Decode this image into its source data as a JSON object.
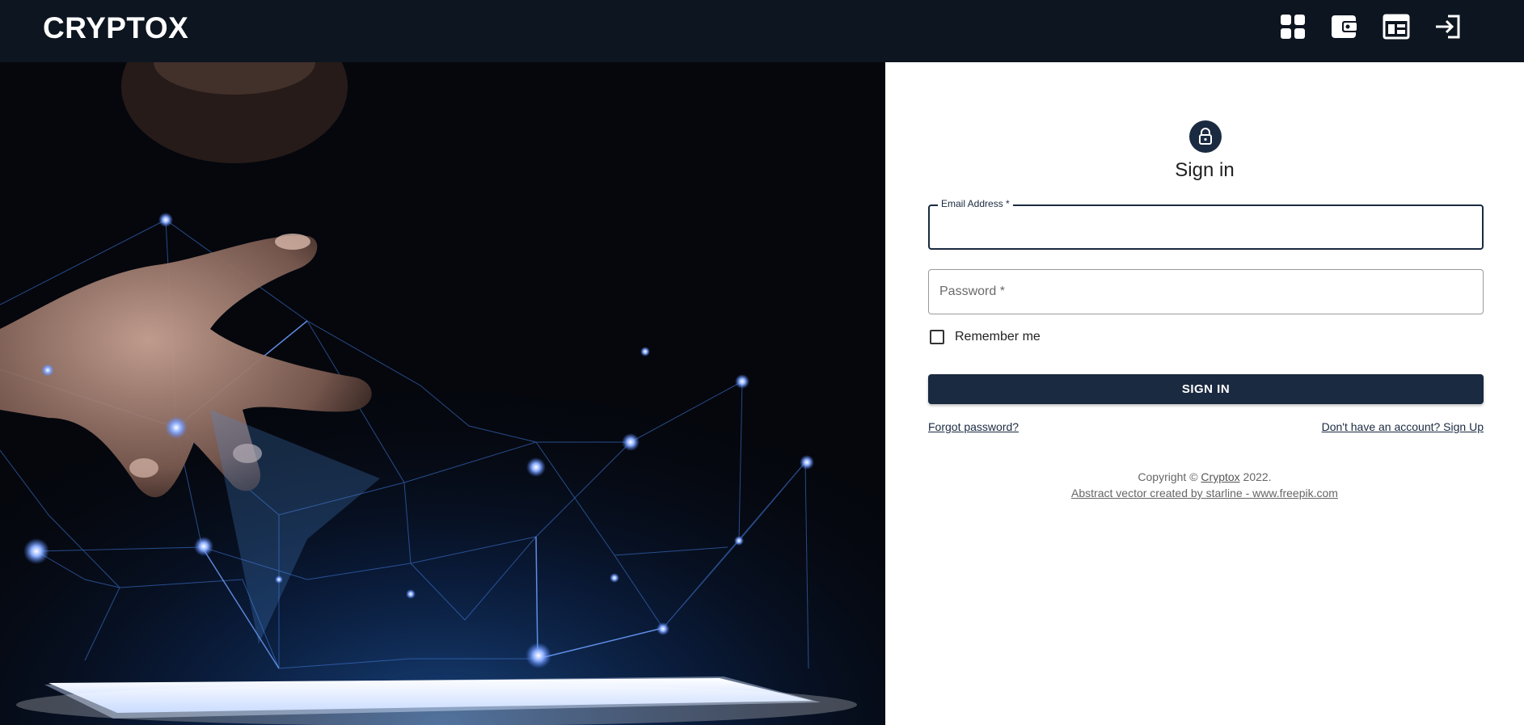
{
  "header": {
    "brand": "CRYPTOX",
    "icons": [
      "dashboard-icon",
      "wallet-icon",
      "calendar-icon",
      "login-icon"
    ]
  },
  "form": {
    "title": "Sign in",
    "email_label": "Email Address *",
    "email_value": "",
    "password_placeholder": "Password *",
    "remember_label": "Remember me",
    "submit_label": "SIGN IN",
    "forgot_link": "Forgot password?",
    "signup_link": "Don't have an account? Sign Up"
  },
  "footer": {
    "copyright_prefix": "Copyright © ",
    "brand_link": "Cryptox",
    "copyright_suffix": " 2022.",
    "credit": "Abstract vector created by starline - www.freepik.com"
  },
  "colors": {
    "topbar": "#0d1520",
    "primary": "#1a2a40",
    "hero_bg": "#05070d",
    "network": "#4a7fff"
  }
}
